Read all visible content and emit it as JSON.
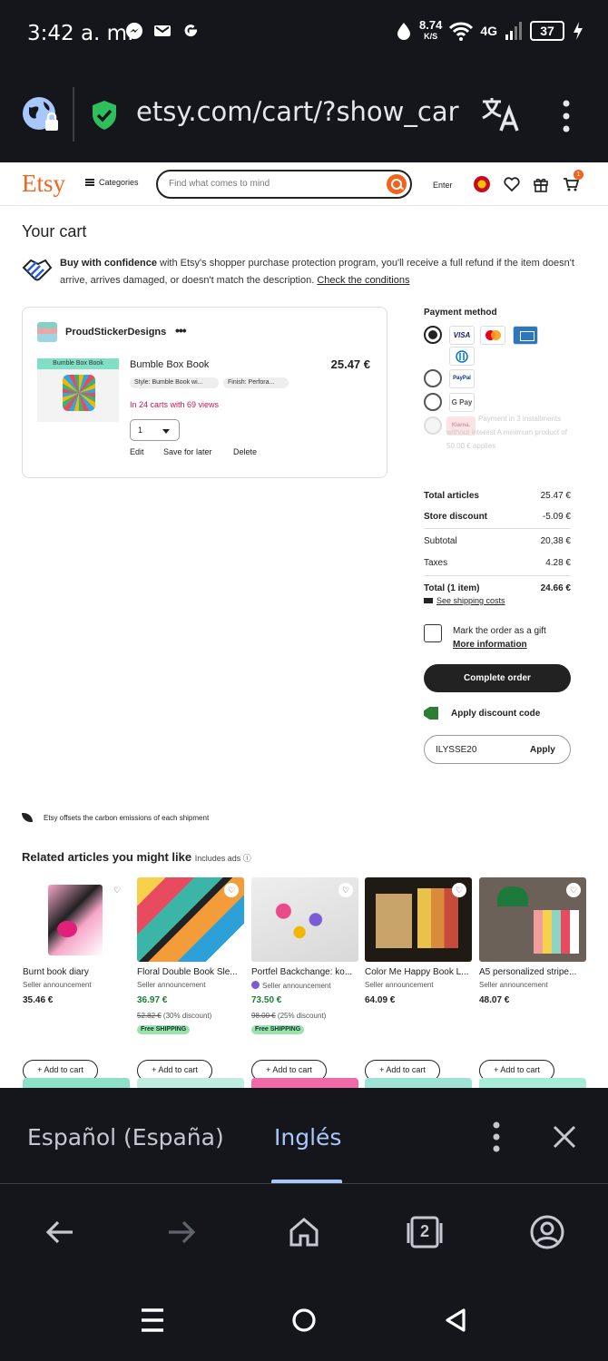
{
  "status_bar": {
    "time": "3:42 a. m.",
    "speed_value": "8.74",
    "speed_unit": "K/S",
    "network": "4G",
    "battery": "37"
  },
  "browser": {
    "url": "etsy.com/cart/?show_car"
  },
  "header": {
    "logo": "Etsy",
    "categories_label": "Categories",
    "search_placeholder": "Find what comes to mind",
    "enter_label": "Enter",
    "cart_count": "1"
  },
  "cart": {
    "title": "Your cart",
    "confidence_bold": "Buy with confidence",
    "confidence_text": " with Etsy's shopper purchase protection program, you'll receive a full refund if the item doesn't arrive, arrives damaged, or doesn't match the description. ",
    "confidence_link": "Check the conditions",
    "shop_name": "ProudStickerDesigns",
    "shop_menu": "•••",
    "item": {
      "image_label": "Bumble Box Book",
      "title": "Bumble Box Book",
      "price": "25.47 €",
      "style_chip": "Style: Bumble Book wi...",
      "finish_chip": "Finish: Perfora...",
      "views": "In 24 carts with 69 views",
      "quantity": "1",
      "actions": [
        "Edit",
        "Save for later",
        "Delete"
      ]
    }
  },
  "payment": {
    "title": "Payment method",
    "klarna_label": "Klarna.",
    "klarna_note": "Payment in 3 installments without interest A minimum product of 50.00 € applies",
    "gpay_label": "G Pay",
    "paypal_label": "PayPal",
    "visa_label": "VISA"
  },
  "summary": {
    "rows": [
      {
        "label": "Total articles",
        "value": "25.47 €"
      },
      {
        "label": "Store discount",
        "value": "-5.09 €"
      },
      {
        "label": "Subtotal",
        "value": "20,38 €"
      },
      {
        "label": "Taxes",
        "value": "4.28 €"
      },
      {
        "label": "Total (1 item)",
        "value": "24.66 €"
      }
    ],
    "shipping_link": "See shipping costs",
    "gift_label": "Mark the order as a gift",
    "gift_link": "More information",
    "complete_button": "Complete order",
    "discount_label": "Apply discount code",
    "code_value": "ILYSSE20",
    "apply_button": "Apply"
  },
  "carbon_note": "Etsy offsets the carbon emissions of each shipment",
  "related": {
    "title": "Related articles you might like",
    "ads_note": "Includes ads ⓘ",
    "add_label": "+ Add to cart",
    "items": [
      {
        "title": "Burnt book diary",
        "seller": "Seller announcement",
        "price": "35.46 €",
        "old": "",
        "free": ""
      },
      {
        "title": "Floral Double Book Sle...",
        "seller": "Seller announcement",
        "price": "36.97 €",
        "old_price": "52.82 €",
        "old_note": " (30% discount)",
        "free": "Free SHIPPING"
      },
      {
        "title": "Portfel Backchange: ko...",
        "seller": "Seller announcement",
        "price": "73.50 €",
        "old_price": "98.00 €",
        "old_note": " (25% discount)",
        "free": "Free SHIPPING"
      },
      {
        "title": "Color Me Happy Book L...",
        "seller": "Seller announcement",
        "price": "64.09 €",
        "old": "",
        "free": ""
      },
      {
        "title": "A5 personalized stripe...",
        "seller": "Seller announcement",
        "price": "48.07 €",
        "old": "",
        "free": ""
      }
    ]
  },
  "translate_bar": {
    "source_lang": "Español (España)",
    "target_lang": "Inglés"
  },
  "bottom_nav": {
    "tabs_count": "2"
  },
  "colors": {
    "etsy_orange": "#f1641e",
    "dark_bg": "#14161c",
    "accent_blue": "#a8c7fa",
    "sale_green": "#1a7f37"
  }
}
